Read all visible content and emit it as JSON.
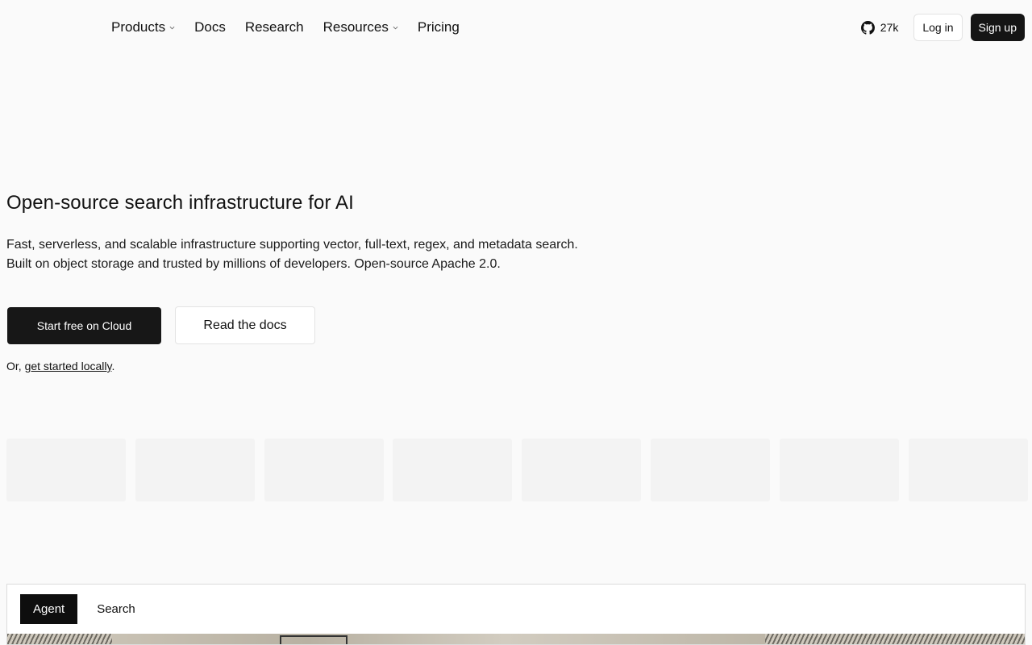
{
  "nav": {
    "items": [
      {
        "label": "Products",
        "dropdown": true
      },
      {
        "label": "Docs",
        "dropdown": false
      },
      {
        "label": "Research",
        "dropdown": false
      },
      {
        "label": "Resources",
        "dropdown": true
      },
      {
        "label": "Pricing",
        "dropdown": false
      }
    ],
    "github_stars": "27k",
    "login_label": "Log in",
    "signup_label": "Sign up"
  },
  "hero": {
    "title": "Open-source search infrastructure for AI",
    "subtitle": "Fast, serverless, and scalable infrastructure supporting vector, full-text, regex, and metadata search. Built on object storage and trusted by millions of developers. Open-source Apache 2.0.",
    "primary_cta": "Start free on Cloud",
    "secondary_cta": "Read the docs",
    "local_prefix": "Or, ",
    "local_link": "get started locally",
    "local_suffix": "."
  },
  "demo": {
    "tabs": [
      {
        "label": "Agent",
        "active": true
      },
      {
        "label": "Search",
        "active": false
      }
    ]
  },
  "colors": {
    "background": "#fafafa",
    "primary_button": "#171717",
    "border": "#e3e3e3"
  }
}
